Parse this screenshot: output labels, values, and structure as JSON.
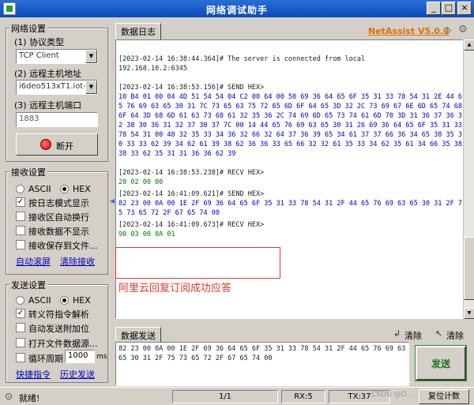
{
  "window": {
    "title": "网络调试助手"
  },
  "brand": "NetAssist V5.0.3",
  "network": {
    "group_title": "网络设置",
    "protocol_label": "(1) 协议类型",
    "protocol_value": "TCP Client",
    "host_label": "(2) 远程主机地址",
    "host_value": "i6deo513xT1.iot-",
    "port_label": "(3) 远程主机端口",
    "port_value": "1883",
    "disconnect_label": "断开"
  },
  "receive": {
    "group_title": "接收设置",
    "ascii": "ASCII",
    "hex": "HEX",
    "options": [
      "按日志模式显示",
      "接收区自动换行",
      "接收数据不显示",
      "接收保存到文件..."
    ],
    "options_checked": [
      true,
      false,
      false,
      false
    ],
    "auto_scroll": "自动滚屏",
    "clear_receive": "清除接收"
  },
  "send": {
    "group_title": "发送设置",
    "ascii": "ASCII",
    "hex": "HEX",
    "options": [
      "转义符指令解析",
      "自动发送附加位",
      "打开文件数据源..."
    ],
    "options_checked": [
      true,
      false,
      false
    ],
    "cycle_label": "循环周期",
    "cycle_value": "1000",
    "cycle_unit": "ms",
    "shortcut_link": "快捷指令",
    "history_link": "历史发送"
  },
  "log": {
    "tab_label": "数据日志",
    "entries": [
      {
        "type": "sys",
        "header": "[2023-02-14 16:38:44.364]# The server is connected from local",
        "body": "192.168.10.2:6345"
      },
      {
        "type": "send",
        "header": "[2023-02-14 16:38:53.156]# SEND HEX>",
        "body": "10 B4 01 00 04 4D 51 54 54 04 C2 00 64 00 50 69 36 64 65 6F 35 31 33 78 54 31 2E 44 65 76 69 63 65 30 31 7C 73 65 63 75 72 65 6D 6F 64 65 3D 32 2C 73 69 67 6E 6D 65 74 68 6F 64 3D 68 6D 61 63 73 68 61 32 35 36 2C 74 69 6D 65 73 74 61 6D 70 3D 31 36 37 36 32 38 30 36 31 32 37 30 37 7C 00 14 44 65 76 69 63 65 30 31 26 69 36 64 65 6F 35 31 33 78 54 31 00 40 32 35 33 34 36 32 66 32 64 37 36 39 65 34 61 37 37 66 36 34 65 38 35 30 33 33 62 39 34 62 61 39 38 62 36 36 33 65 66 32 32 61 35 33 34 62 35 61 34 66 35 38 38 33 62 35 31 31 36 36 62 39"
      },
      {
        "type": "recv",
        "header": "[2023-02-14 16:38:53.238]# RECV HEX>",
        "body": "20 02 00 00"
      },
      {
        "type": "send",
        "header": "[2023-02-14 16:41:09.621]# SEND HEX>",
        "body": "82 23 00 0A 00 1E 2F 69 36 64 65 6F 35 31 33 78 54 31 2F 44 65 76 69 63 65 30 31 2F 75 73 65 72 2F 67 65 74 00"
      },
      {
        "type": "recv",
        "header": "[2023-02-14 16:41:09.673]# RECV HEX>",
        "body": "90 03 00 0A 01"
      }
    ],
    "annotation": "阿里云回复订阅成功应答"
  },
  "send_panel": {
    "tab_label": "数据发送",
    "clear1": "清除",
    "clear2": "清除",
    "content": "82 23 00 0A 00 1E 2F 69 36 64 65 6F 35 31 33 78 54 31 2F 44 65 76 69 63 65 30 31 2F 75 73 65 72 2F 67 65 74 00",
    "send_button": "发送"
  },
  "status": {
    "state": "就绪!",
    "page": "1/1",
    "rx": "RX:5",
    "tx": "TX:37",
    "reset": "复位计数",
    "watermark": "CSDN @O..."
  },
  "colors": {
    "send": "#0000c8",
    "recv": "#007a00",
    "annotation": "#e8352d",
    "brand": "#e07000"
  }
}
